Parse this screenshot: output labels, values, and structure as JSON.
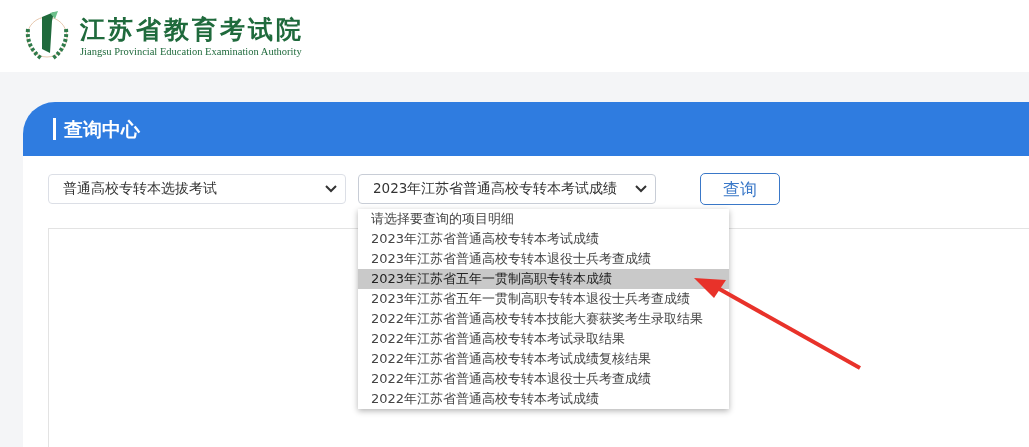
{
  "logo": {
    "title": "江苏省教育考试院",
    "subtitle": "Jiangsu Provincial Education Examination Authority"
  },
  "panel": {
    "title": "查询中心"
  },
  "exam_select": {
    "value": "普通高校专转本选拔考试"
  },
  "item_select": {
    "value": "2023年江苏省普通高校专转本考试成绩",
    "expanded": true,
    "options": [
      {
        "label": "请选择要查询的项目明细",
        "highlighted": false
      },
      {
        "label": "2023年江苏省普通高校专转本考试成绩",
        "highlighted": false
      },
      {
        "label": "2023年江苏省普通高校专转本退役士兵考查成绩",
        "highlighted": false
      },
      {
        "label": "2023年江苏省五年一贯制高职专转本成绩",
        "highlighted": true
      },
      {
        "label": "2023年江苏省五年一贯制高职专转本退役士兵考查成绩",
        "highlighted": false
      },
      {
        "label": "2022年江苏省普通高校专转本技能大赛获奖考生录取结果",
        "highlighted": false
      },
      {
        "label": "2022年江苏省普通高校专转本考试录取结果",
        "highlighted": false
      },
      {
        "label": "2022年江苏省普通高校专转本考试成绩复核结果",
        "highlighted": false
      },
      {
        "label": "2022年江苏省普通高校专转本退役士兵考查成绩",
        "highlighted": false
      },
      {
        "label": "2022年江苏省普通高校专转本考试成绩",
        "highlighted": false
      }
    ]
  },
  "query_button": {
    "label": "查询"
  }
}
